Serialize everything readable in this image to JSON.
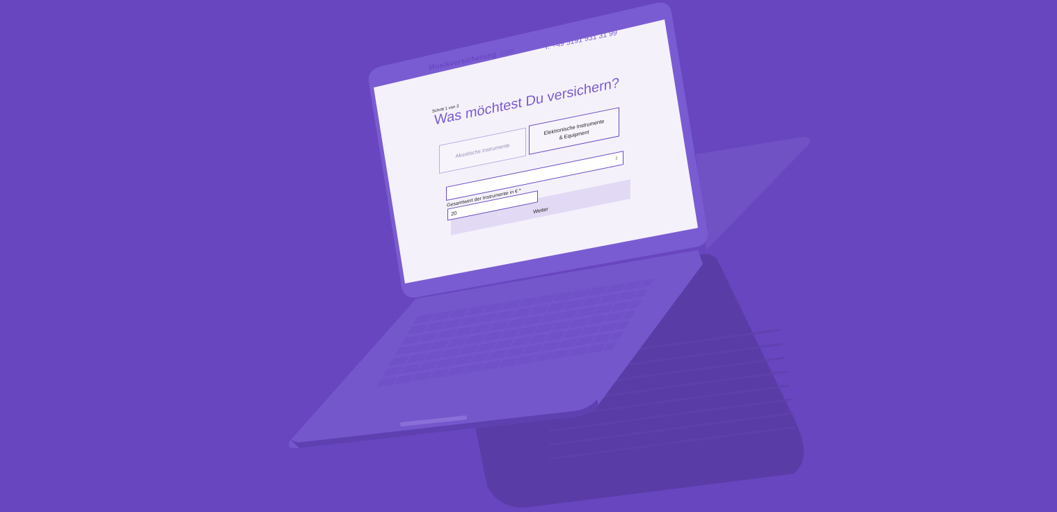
{
  "colors": {
    "background": "#6846c0",
    "laptop_body": "#7456cc",
    "laptop_shadow": "#5a3ca6",
    "screen_bg": "#f5f1fb",
    "accent": "#6a48c4"
  },
  "header": {
    "brand_name": "Musikversicherung",
    "brand_tld": ".com",
    "phone": "T: +49 5191 931 31 99"
  },
  "form": {
    "step": "Schritt 1 von 3",
    "title": "Was möchtest Du versichern?",
    "options": [
      {
        "label": "Akustische Instrumente",
        "selected": false
      },
      {
        "label": "Elektronische Instrumente & Equipment",
        "selected": true
      }
    ],
    "value_label": "Gesamtwert der Instrumente in € *",
    "value_input": "20",
    "select_icon": "updown-arrows-icon",
    "submit_label": "Weiter"
  }
}
